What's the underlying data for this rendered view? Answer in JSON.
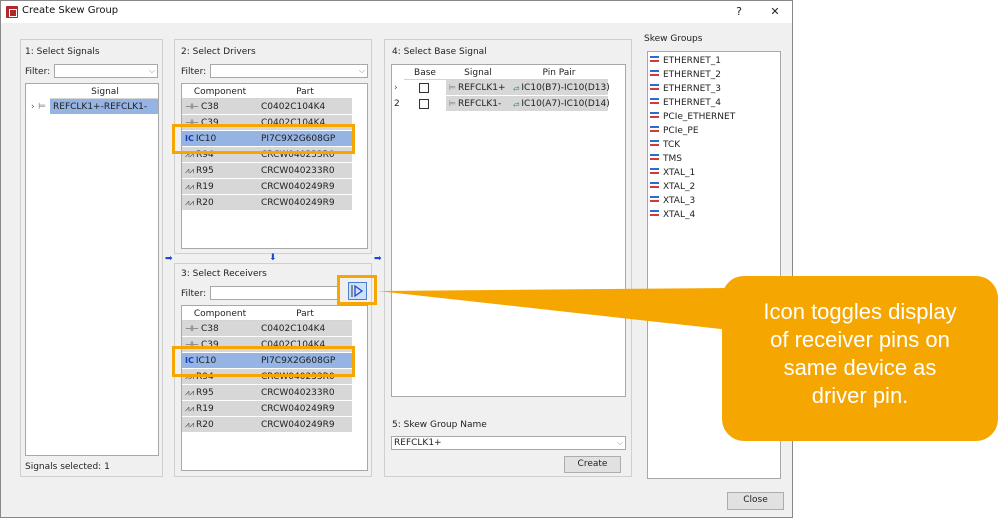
{
  "window": {
    "title": "Create Skew Group",
    "help_btn": "?",
    "close_btn": "✕"
  },
  "signals": {
    "header": "1:  Select Signals",
    "filter_label": "Filter:",
    "filter_value": "",
    "column": "Signal",
    "rows": [
      {
        "expander": "›",
        "name": "REFCLK1+-REFCLK1-"
      }
    ],
    "status": "Signals selected: 1"
  },
  "drivers": {
    "header": "2:  Select Drivers",
    "filter_label": "Filter:",
    "col_component": "Component",
    "col_part": "Part",
    "rows": [
      {
        "sym": "⊣⊢",
        "component": "C38",
        "part": "C0402C104K4",
        "icon": "capacitor-icon"
      },
      {
        "sym": "⊣⊢",
        "component": "C39",
        "part": "C0402C104K4",
        "icon": "capacitor-icon"
      },
      {
        "sym": "IC",
        "component": "IC10",
        "part": "PI7C9X2G608GP",
        "icon": "ic-icon"
      },
      {
        "sym": "⩘⩘",
        "component": "R94",
        "part": "CRCW040233R0",
        "icon": "resistor-icon"
      },
      {
        "sym": "⩘⩘",
        "component": "R95",
        "part": "CRCW040233R0",
        "icon": "resistor-icon"
      },
      {
        "sym": "⩘⩘",
        "component": "R19",
        "part": "CRCW040249R9",
        "icon": "resistor-icon"
      },
      {
        "sym": "⩘⩘",
        "component": "R20",
        "part": "CRCW040249R9",
        "icon": "resistor-icon"
      }
    ]
  },
  "receivers": {
    "header": "3:  Select Receivers",
    "filter_label": "Filter:",
    "col_component": "Component",
    "col_part": "Part",
    "toggle_icon": "show-same-device-pins-icon",
    "rows": [
      {
        "sym": "⊣⊢",
        "component": "C38",
        "part": "C0402C104K4",
        "icon": "capacitor-icon"
      },
      {
        "sym": "⊣⊢",
        "component": "C39",
        "part": "C0402C104K4",
        "icon": "capacitor-icon"
      },
      {
        "sym": "IC",
        "component": "IC10",
        "part": "PI7C9X2G608GP",
        "icon": "ic-icon"
      },
      {
        "sym": "⩘⩘",
        "component": "R94",
        "part": "CRCW040233R0",
        "icon": "resistor-icon"
      },
      {
        "sym": "⩘⩘",
        "component": "R95",
        "part": "CRCW040233R0",
        "icon": "resistor-icon"
      },
      {
        "sym": "⩘⩘",
        "component": "R19",
        "part": "CRCW040249R9",
        "icon": "resistor-icon"
      },
      {
        "sym": "⩘⩘",
        "component": "R20",
        "part": "CRCW040249R9",
        "icon": "resistor-icon"
      }
    ]
  },
  "base_signal": {
    "header": "4:  Select Base Signal",
    "col_base": "Base",
    "col_signal": "Signal",
    "col_pin_pair": "Pin Pair",
    "rows": [
      {
        "index": "›",
        "signal": "REFCLK1+",
        "pin_pair": "IC10(B7)-IC10(D13)"
      },
      {
        "index": "2",
        "signal": "REFCLK1-",
        "pin_pair": "IC10(A7)-IC10(D14)"
      }
    ]
  },
  "skew_group_name": {
    "header": "5:  Skew Group Name",
    "value": "REFCLK1+",
    "create_btn": "Create"
  },
  "skew_groups": {
    "header": "Skew Groups",
    "items": [
      "ETHERNET_1",
      "ETHERNET_2",
      "ETHERNET_3",
      "ETHERNET_4",
      "PCIe_ETHERNET",
      "PCIe_PE",
      "TCK",
      "TMS",
      "XTAL_1",
      "XTAL_2",
      "XTAL_3",
      "XTAL_4"
    ]
  },
  "close_btn": "Close",
  "callout": {
    "lines": [
      "Icon toggles display",
      "of receiver pins on",
      "same device as",
      "driver pin."
    ]
  },
  "colors": {
    "accent": "#f5a600",
    "selection": "#95b3e3",
    "row_bg": "#d7d7d7"
  }
}
